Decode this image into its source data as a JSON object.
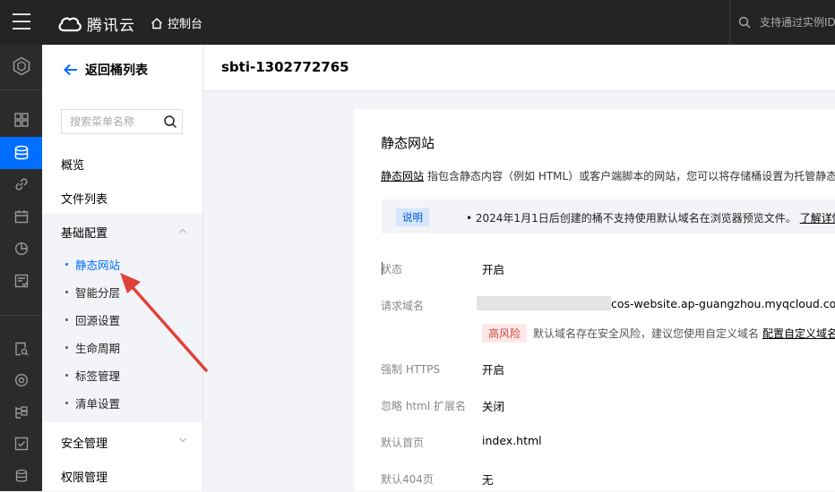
{
  "topbar": {
    "brand": "腾讯云",
    "console_label": "控制台",
    "search_placeholder": "支持通过实例ID"
  },
  "sidebar": {
    "back_label": "返回桶列表",
    "search_placeholder": "搜索菜单名称",
    "items": {
      "overview": "概览",
      "files": "文件列表",
      "basic_config": "基础配置",
      "security": "安全管理",
      "permissions": "权限管理"
    },
    "sub_items": [
      "静态网站",
      "智能分层",
      "回源设置",
      "生命周期",
      "标签管理",
      "清单设置"
    ],
    "active_sub_item": "静态网站"
  },
  "header": {
    "bucket_name": "sbti-1302772765"
  },
  "content": {
    "title": "静态网站",
    "desc_link": "静态网站",
    "desc_text": "指包含静态内容（例如 HTML）或客户端脚本的网站，您可以将存储桶设置为托管静态",
    "notice_tag": "说明",
    "notice_text": "• 2024年1月1日后创建的桶不支持使用默认域名在浏览器预览文件。",
    "notice_link": "了解详情",
    "rows": {
      "status_label": "状态",
      "status_value": "开启",
      "domain_label": "请求域名",
      "domain_value": "cos-website.ap-guangzhou.myqcloud.com",
      "risk_tag": "高风险",
      "risk_text": "默认域名存在安全风险，建议您使用自定义域名",
      "risk_link": "配置自定义域名",
      "https_label": "强制 HTTPS",
      "https_value": "开启",
      "ignore_ext_label": "忽略 html 扩展名",
      "ignore_ext_value": "关闭",
      "index_label": "默认首页",
      "index_value": "index.html",
      "notfound_label": "默认404页",
      "notfound_value": "无"
    }
  },
  "colors": {
    "accent": "#006eff",
    "topbar_bg": "#242424",
    "rail_bg": "#2b2b2b",
    "annotation_arrow": "#e0413a",
    "risk": "#d54941"
  }
}
